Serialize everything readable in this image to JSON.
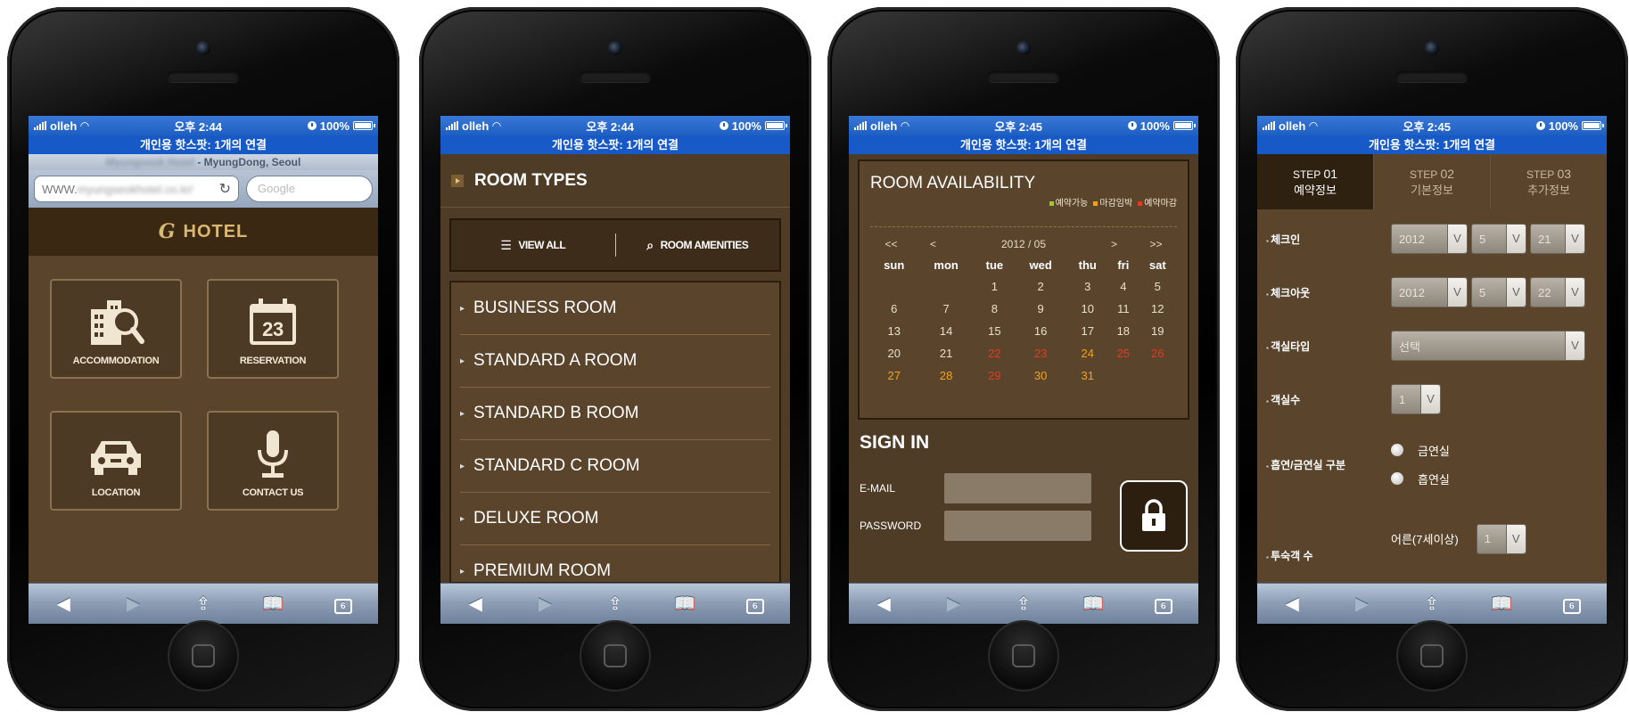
{
  "status": {
    "carrier": "olleh",
    "time_1": "오후 2:44",
    "time_2": "오후 2:44",
    "time_3": "오후 2:45",
    "time_4": "오후 2:45",
    "battery": "100%",
    "hotspot": "개인용 핫스팟: 1개의 연결"
  },
  "toolbar": {
    "tabs_count": "6"
  },
  "screen1": {
    "page_title": "- MyungDong, Seoul",
    "url": "WWW.",
    "search_placeholder": "Google",
    "logo": "HOTEL",
    "tiles": [
      "ACCOMMODATION",
      "RESERVATION",
      "LOCATION",
      "CONTACT US"
    ],
    "calendar_icon_day": "23"
  },
  "screen2": {
    "heading": "ROOM TYPES",
    "view_all": "VIEW ALL",
    "room_amenities": "ROOM AMENITIES",
    "rooms": [
      "BUSINESS ROOM",
      "STANDARD A ROOM",
      "STANDARD B ROOM",
      "STANDARD C ROOM",
      "DELUXE ROOM",
      "PREMIUM ROOM"
    ]
  },
  "screen3": {
    "title": "ROOM AVAILABILITY",
    "legend": [
      {
        "label": "예약가능",
        "color": "#9ccc2c"
      },
      {
        "label": "마감임박",
        "color": "#f3a21c"
      },
      {
        "label": "예약마감",
        "color": "#e23a23"
      }
    ],
    "nav": {
      "first": "<<",
      "prev": "<",
      "month": "2012 / 05",
      "next": ">",
      "last": ">>"
    },
    "weekdays": [
      "sun",
      "mon",
      "tue",
      "wed",
      "thu",
      "fri",
      "sat"
    ],
    "weeks": [
      [
        "",
        "",
        "1",
        "2",
        "3",
        "4",
        "5"
      ],
      [
        "6",
        "7",
        "8",
        "9",
        "10",
        "11",
        "12"
      ],
      [
        "13",
        "14",
        "15",
        "16",
        "17",
        "18",
        "19"
      ],
      [
        "20",
        "21",
        "22",
        "23",
        "24",
        "25",
        "26"
      ],
      [
        "27",
        "28",
        "29",
        "30",
        "31",
        "",
        ""
      ]
    ],
    "signin_title": "SIGN IN",
    "email_label": "E-MAIL",
    "password_label": "PASSWORD"
  },
  "screen4": {
    "steps": [
      {
        "n": "STEP",
        "num": "01",
        "label": "예약정보"
      },
      {
        "n": "STEP",
        "num": "02",
        "label": "기본정보"
      },
      {
        "n": "STEP",
        "num": "03",
        "label": "추가정보"
      }
    ],
    "checkin_label": "체크인",
    "checkin": {
      "year": "2012",
      "month": "5",
      "day": "21"
    },
    "checkout_label": "체크아웃",
    "checkout": {
      "year": "2012",
      "month": "5",
      "day": "22"
    },
    "roomtype_label": "객실타입",
    "roomtype_value": "선택",
    "roomcount_label": "객실수",
    "roomcount_value": "1",
    "smoking_label": "흡연/금연실 구분",
    "smoking_options": [
      "금연실",
      "흡연실"
    ],
    "guests_label": "투숙객 수",
    "adult_label": "어른(7세이상)",
    "adult_value": "1"
  }
}
